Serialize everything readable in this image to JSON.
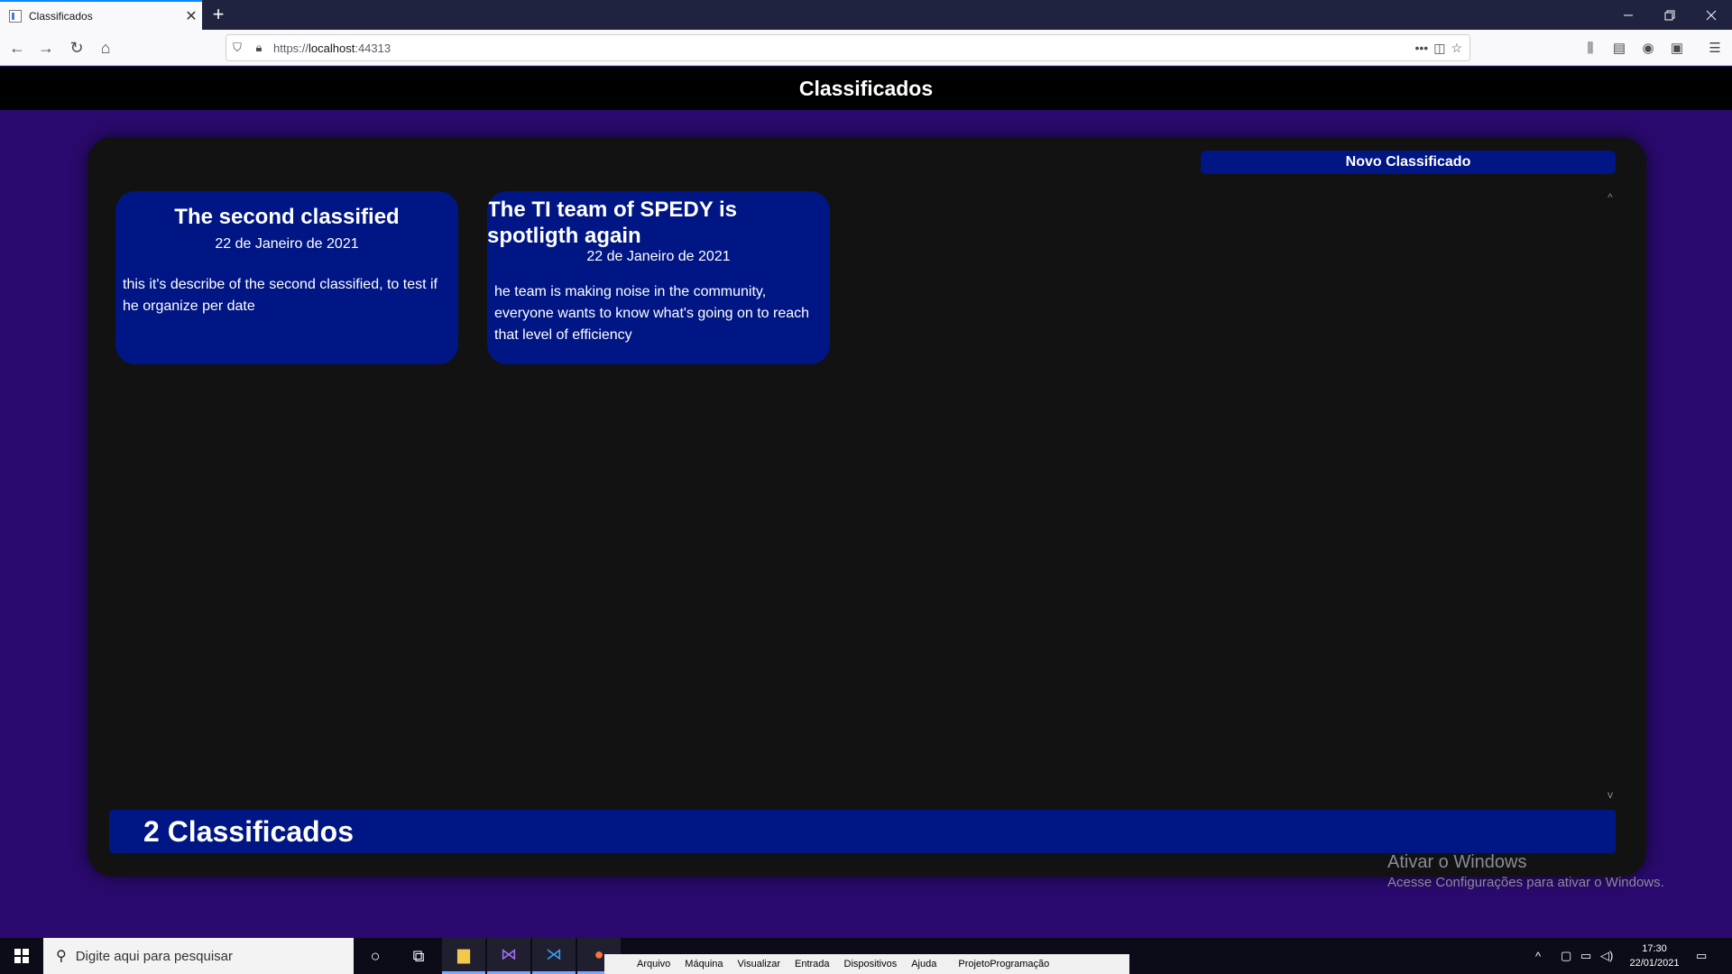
{
  "browser": {
    "tab_title": "Classificados",
    "new_tab_symbol": "+",
    "close_tab_symbol": "✕",
    "url_prefix": "https://",
    "url_host": "localhost",
    "url_port": ":44313"
  },
  "app": {
    "header_title": "Classificados",
    "new_button_label": "Novo Classificado",
    "count_label": "2 Classificados"
  },
  "classifieds": [
    {
      "title": "The second classified",
      "date": "22 de Janeiro de 2021",
      "description": "this it's describe of the second classified, to test if he organize per date"
    },
    {
      "title": "The TI team of SPEDY is spotligth again",
      "date": "22 de Janeiro de 2021",
      "description": "he team is making noise in the community, everyone wants to know what's going on to reach that level of efficiency"
    }
  ],
  "watermark": {
    "line1": "Ativar o Windows",
    "line2": "Acesse Configurações para ativar o Windows."
  },
  "taskbar": {
    "search_placeholder": "Digite aqui para pesquisar",
    "vm_menu": [
      "Arquivo",
      "Máquina",
      "Visualizar",
      "Entrada",
      "Dispositivos",
      "Ajuda",
      "ProjetoProgramação"
    ],
    "time": "17:30",
    "date": "22/01/2021"
  },
  "colors": {
    "page_bg": "#2a0a6e",
    "card_bg": "#001684",
    "panel_bg": "#121212",
    "header_bg": "#000000"
  }
}
